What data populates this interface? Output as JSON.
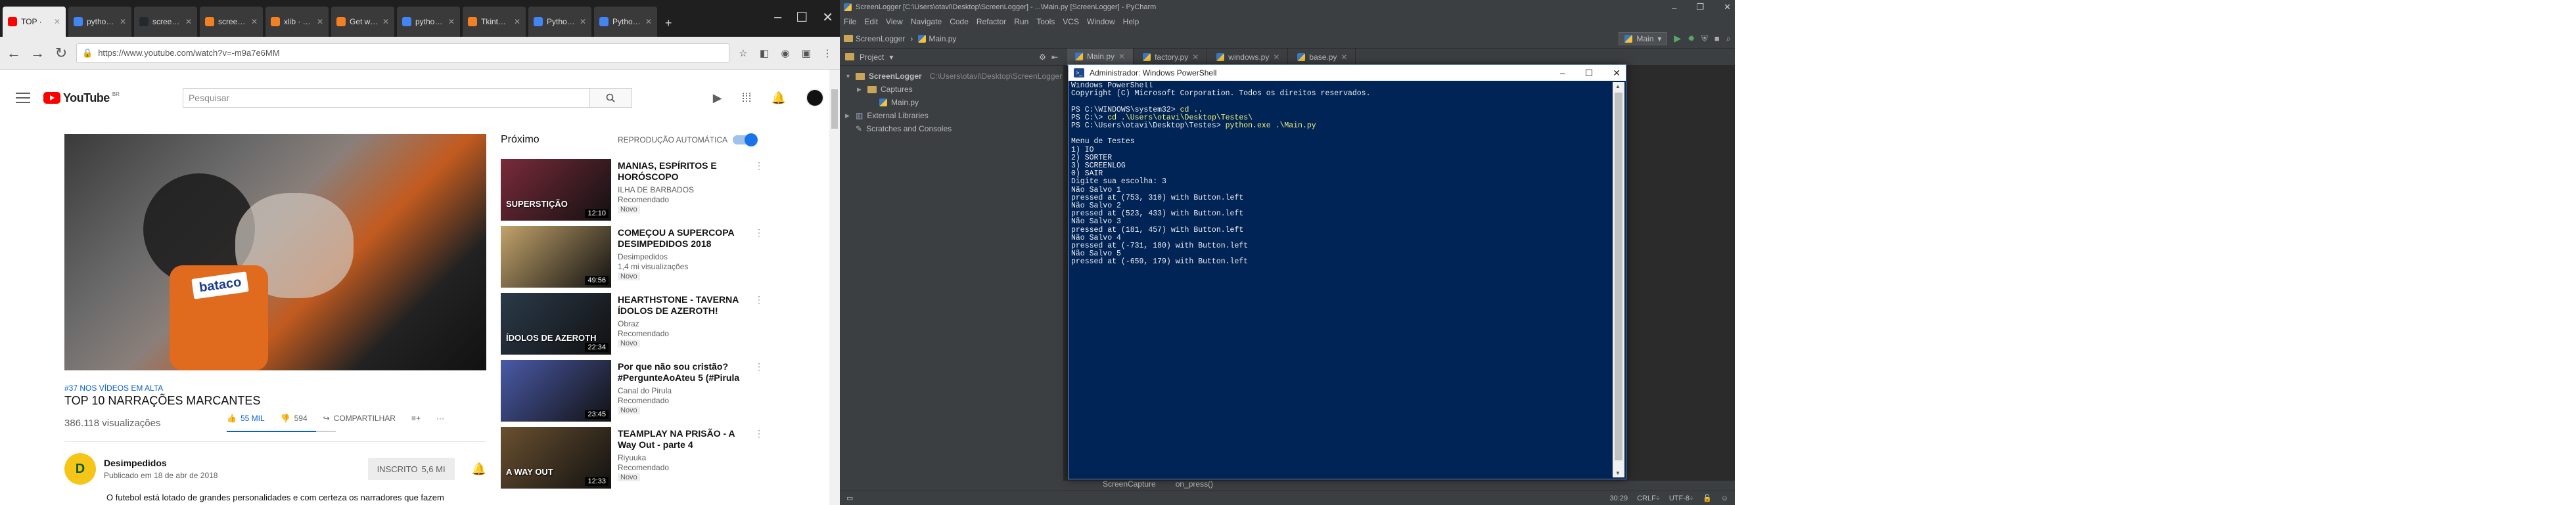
{
  "browser": {
    "tabs": [
      {
        "label": "TOP ·",
        "color": "#ff0000"
      },
      {
        "label": "python scre",
        "color": "#4285f4"
      },
      {
        "label": "screeninfo",
        "color": "#24292e"
      },
      {
        "label": "screen · H",
        "color": "#f48024"
      },
      {
        "label": "xlib · Get sc",
        "color": "#f48024"
      },
      {
        "label": "Get windo",
        "color": "#f48024"
      },
      {
        "label": "python · G",
        "color": "#4285f4"
      },
      {
        "label": "Tkinter: hid",
        "color": "#f48024"
      },
      {
        "label": "Python · D",
        "color": "#4285f4"
      },
      {
        "label": "Python ·",
        "color": "#4285f4"
      }
    ],
    "url": "https://www.youtube.com/watch?v=-m9a7e6MM"
  },
  "youtube": {
    "logo_text": "YouTube",
    "logo_country": "BR",
    "search_placeholder": "Pesquisar",
    "video": {
      "hashtag": "#37 NOS VÍDEOS EM ALTA",
      "title": "TOP 10 NARRAÇÕES MARCANTES",
      "views": "386.118 visualizações",
      "likes": "55 MIL",
      "dislikes": "594",
      "share_label": "COMPARTILHAR",
      "player_badge": "bataco"
    },
    "channel": {
      "name": "Desimpedidos",
      "published": "Publicado em 18 de abr de 2018",
      "subscribe_label": "INSCRITO",
      "subscriber_count": "5,6 MI",
      "description": "O futebol está lotado de grandes personalidades e com certeza os narradores que fazem"
    },
    "up_next_title": "Próximo",
    "autoplay_label": "REPRODUÇÃO AUTOMÁTICA",
    "autoplay_on": true,
    "up_next": [
      {
        "title": "MANIAS, ESPÍRITOS E HORÓSCOPO",
        "channel": "ILHA DE BARBADOS",
        "meta": "Recomendado",
        "badge": "Novo",
        "duration": "12:10",
        "thumb_text": "SUPERSTIÇÃO",
        "thumb_color": "#7a2a3a"
      },
      {
        "title": "COMEÇOU A SUPERCOPA DESIMPEDIDOS 2018",
        "channel": "Desimpedidos",
        "meta": "1,4 mi visualizações",
        "badge": "Novo",
        "duration": "49:56",
        "thumb_text": "",
        "thumb_color": "#c2a36b"
      },
      {
        "title": "HEARTHSTONE - TAVERNA ÍDOLOS DE AZEROTH!",
        "channel": "Obraz",
        "meta": "Recomendado",
        "badge": "Novo",
        "duration": "22:34",
        "thumb_text": "ÍDOLOS DE AZEROTH",
        "thumb_color": "#2b3a4a"
      },
      {
        "title": "Por que não sou cristão? #PergunteAoAteu 5 (#Pirula",
        "channel": "Canal do Pirula",
        "meta": "Recomendado",
        "badge": "Novo",
        "duration": "23:45",
        "thumb_text": "",
        "thumb_color": "#4a5aa8"
      },
      {
        "title": "TEAMPLAY NA PRISÃO - A Way Out - parte 4",
        "channel": "Riyuuka",
        "meta": "Recomendado",
        "badge": "Novo",
        "duration": "12:33",
        "thumb_text": "A WAY OUT",
        "thumb_color": "#6a5030"
      }
    ]
  },
  "pycharm": {
    "title": "ScreenLogger [C:\\Users\\otavi\\Desktop\\ScreenLogger] - ...\\Main.py [ScreenLogger] - PyCharm",
    "menu": [
      "File",
      "Edit",
      "View",
      "Navigate",
      "Code",
      "Refactor",
      "Run",
      "Tools",
      "VCS",
      "Window",
      "Help"
    ],
    "breadcrumb": [
      "ScreenLogger",
      "Main.py"
    ],
    "run_config": "Main",
    "project_label": "Project",
    "editor_tabs": [
      "Main.py",
      "factory.py",
      "windows.py",
      "base.py"
    ],
    "tree": [
      {
        "label": "ScreenLogger",
        "path": "C:\\Users\\otavi\\Desktop\\ScreenLogger",
        "depth": 0,
        "arrow": "▼",
        "icon": "folder",
        "bold": true
      },
      {
        "label": "Captures",
        "path": "",
        "depth": 1,
        "arrow": "▶",
        "icon": "folder",
        "bold": false
      },
      {
        "label": "Main.py",
        "path": "",
        "depth": 2,
        "arrow": "",
        "icon": "py",
        "bold": false
      },
      {
        "label": "External Libraries",
        "path": "",
        "depth": 0,
        "arrow": "▶",
        "icon": "lib",
        "bold": false
      },
      {
        "label": "Scratches and Consoles",
        "path": "",
        "depth": 0,
        "arrow": "",
        "icon": "scratch",
        "bold": false
      }
    ],
    "bottom_breadcrumb": [
      "ScreenCapture",
      "on_press()"
    ],
    "status": {
      "position": "30:29",
      "line_sep": "CRLF÷",
      "encoding": "UTF-8÷"
    }
  },
  "powershell": {
    "title": "Administrador: Windows PowerShell",
    "lines": [
      {
        "text": "Windows PowerShell",
        "cmd": ""
      },
      {
        "text": "Copyright (C) Microsoft Corporation. Todos os direitos reservados.",
        "cmd": ""
      },
      {
        "text": "",
        "cmd": ""
      },
      {
        "text": "PS C:\\WINDOWS\\system32> ",
        "cmd": "cd .."
      },
      {
        "text": "PS C:\\> ",
        "cmd": "cd .\\Users\\otavi\\Desktop\\Testes\\"
      },
      {
        "text": "PS C:\\Users\\otavi\\Desktop\\Testes> ",
        "cmd": "python.exe .\\Main.py"
      },
      {
        "text": "",
        "cmd": ""
      },
      {
        "text": "Menu de Testes",
        "cmd": ""
      },
      {
        "text": "1) IO",
        "cmd": ""
      },
      {
        "text": "2) SORTER",
        "cmd": ""
      },
      {
        "text": "3) SCREENLOG",
        "cmd": ""
      },
      {
        "text": "0) SAIR",
        "cmd": ""
      },
      {
        "text": "Digite sua escolha: 3",
        "cmd": ""
      },
      {
        "text": "Não Salvo 1",
        "cmd": ""
      },
      {
        "text": "pressed at (753, 310) with Button.left",
        "cmd": ""
      },
      {
        "text": "Não Salvo 2",
        "cmd": ""
      },
      {
        "text": "pressed at (523, 433) with Button.left",
        "cmd": ""
      },
      {
        "text": "Não Salvo 3",
        "cmd": ""
      },
      {
        "text": "pressed at (181, 457) with Button.left",
        "cmd": ""
      },
      {
        "text": "Não Salvo 4",
        "cmd": ""
      },
      {
        "text": "pressed at (-731, 180) with Button.left",
        "cmd": ""
      },
      {
        "text": "Não Salvo 5",
        "cmd": ""
      },
      {
        "text": "pressed at (-659, 179) with Button.left",
        "cmd": ""
      }
    ]
  },
  "colors": {
    "youtube_red": "#ff0000",
    "link_blue": "#065fd4",
    "ps_bg": "#012456",
    "ide_bg": "#3c3f41"
  }
}
